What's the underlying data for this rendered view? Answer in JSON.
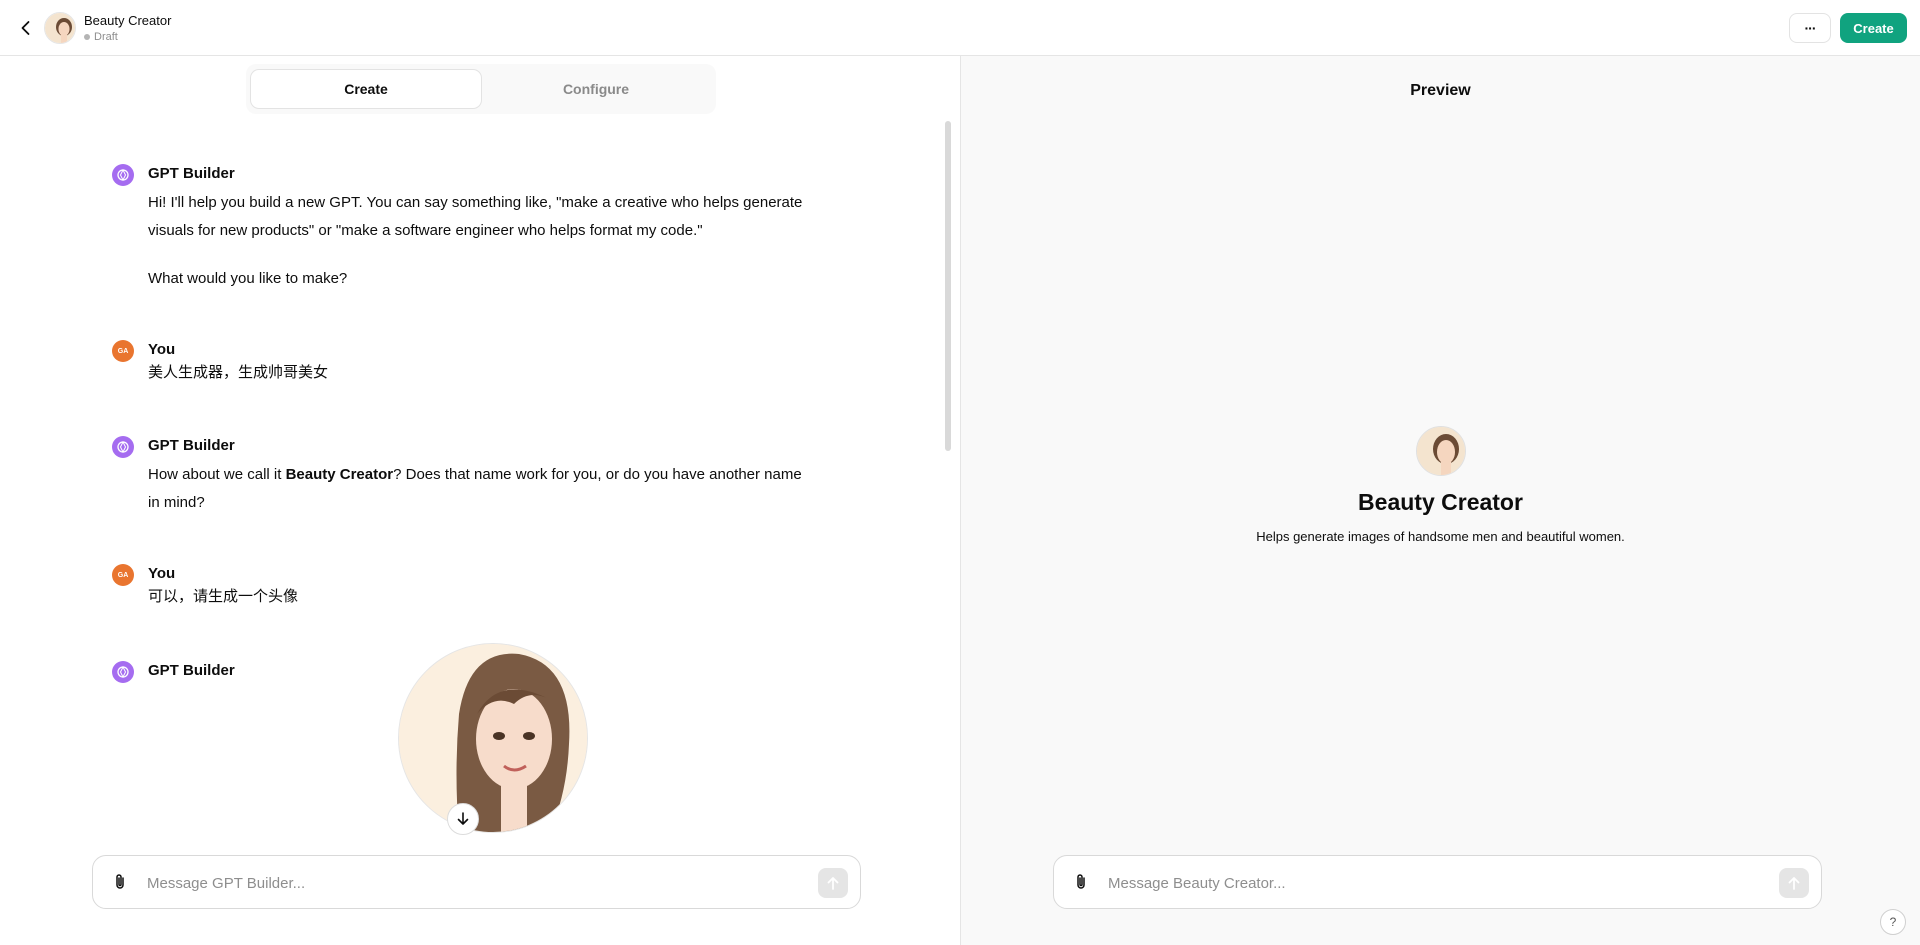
{
  "header": {
    "gpt_name": "Beauty Creator",
    "status": "Draft",
    "more_label": "···",
    "create_label": "Create"
  },
  "tabs": [
    {
      "label": "Create",
      "active": true
    },
    {
      "label": "Configure",
      "active": false
    }
  ],
  "messages": [
    {
      "author": "GPT Builder",
      "role": "builder",
      "line1": "Hi! I'll help you build a new GPT. You can say something like, \"make a creative who helps generate",
      "line2": "visuals for new products\" or \"make a software engineer who helps format my code.\"",
      "line3": "What would you like to make?"
    },
    {
      "author": "You",
      "role": "user",
      "initials": "GA",
      "text": "美人生成器，生成帅哥美女"
    },
    {
      "author": "GPT Builder",
      "role": "builder",
      "pre": "How about we call it ",
      "bold": "Beauty Creator",
      "post": "? Does that name work for you, or do you have another name",
      "line2": "in mind?"
    },
    {
      "author": "You",
      "role": "user",
      "initials": "GA",
      "text": "可以，请生成一个头像"
    },
    {
      "author": "GPT Builder",
      "role": "builder"
    }
  ],
  "composer_left": {
    "placeholder": "Message GPT Builder..."
  },
  "preview": {
    "title": "Preview",
    "name": "Beauty Creator",
    "description": "Helps generate images of handsome men and beautiful women.",
    "composer_placeholder": "Message Beauty Creator...",
    "help_label": "?"
  },
  "colors": {
    "accent": "#10a37f",
    "builder_avatar": "#a56cf0",
    "user_avatar": "#e9752f"
  }
}
